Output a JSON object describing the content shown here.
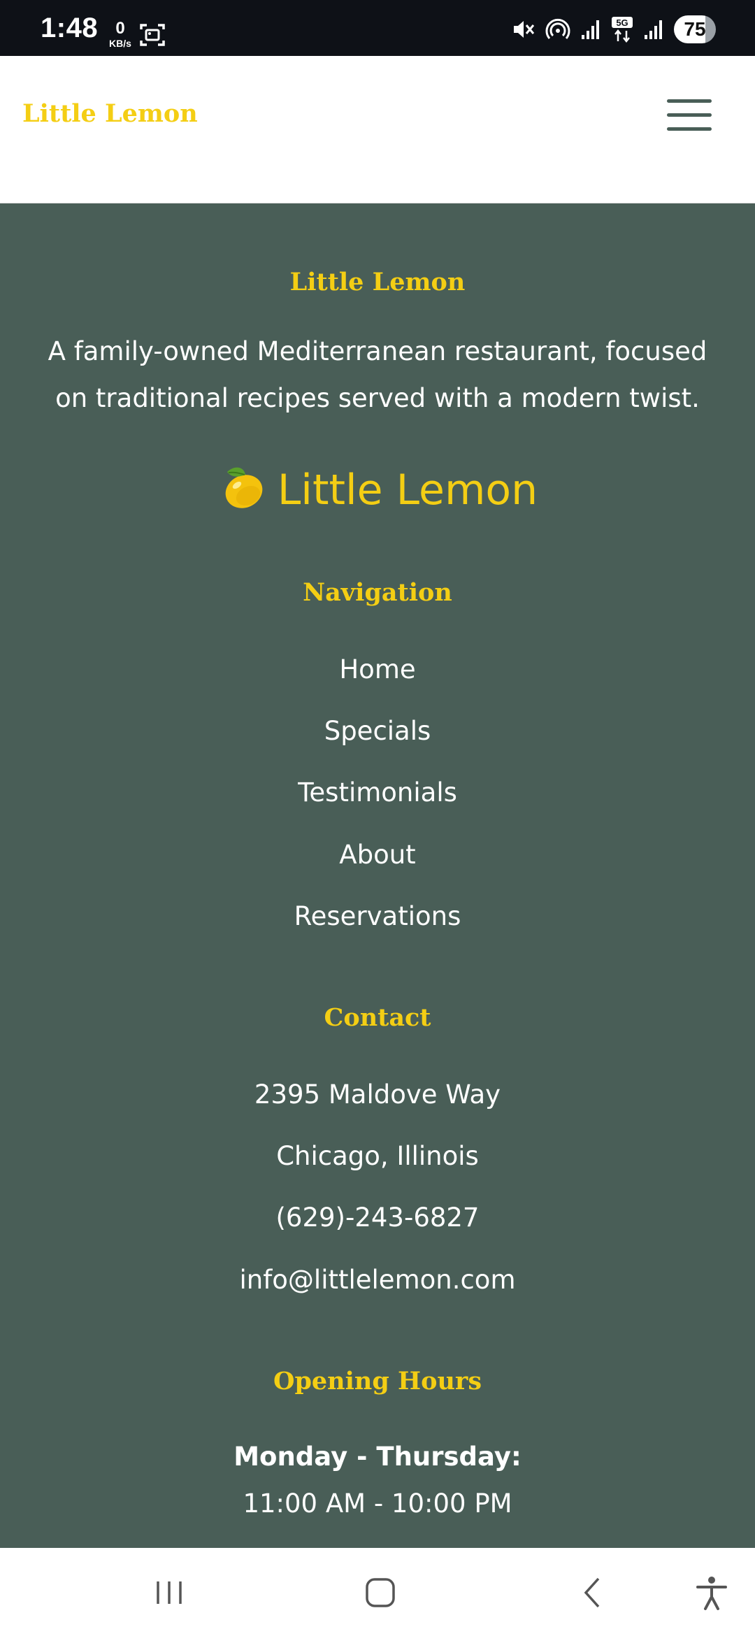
{
  "status_bar": {
    "time": "1:48",
    "net_speed_value": "0",
    "net_speed_unit": "KB/s",
    "battery": "75",
    "icons": [
      "screenshot-icon",
      "mute-icon",
      "hotspot-icon",
      "signal-icon",
      "5g-icon",
      "signal-icon"
    ]
  },
  "header": {
    "brand": "Little Lemon",
    "menu_icon": "hamburger-icon"
  },
  "footer": {
    "title": "Little Lemon",
    "description": "A family-owned Mediterranean restaurant, focused on traditional recipes served with a modern twist.",
    "logo_text": "Little Lemon",
    "logo_icon": "lemon-icon",
    "navigation": {
      "heading": "Navigation",
      "links": [
        "Home",
        "Specials",
        "Testimonials",
        "About",
        "Reservations"
      ]
    },
    "contact": {
      "heading": "Contact",
      "lines": [
        "2395 Maldove Way",
        "Chicago, Illinois",
        "(629)-243-6827",
        "info@littlelemon.com"
      ]
    },
    "hours": {
      "heading": "Opening Hours",
      "day": "Monday - Thursday:",
      "time": "11:00 AM - 10:00 PM"
    }
  },
  "system_nav": {
    "buttons": [
      "recent-apps-icon",
      "home-icon",
      "back-icon",
      "accessibility-icon"
    ]
  },
  "colors": {
    "brand_yellow": "#F4CE14",
    "footer_green": "#495E57",
    "status_bar": "#0E1117",
    "white": "#FFFFFF"
  }
}
